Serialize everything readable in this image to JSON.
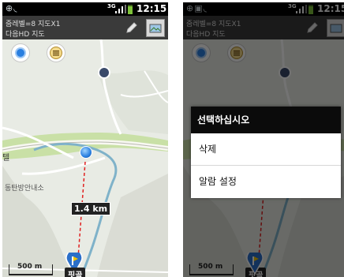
{
  "statusbar": {
    "network": "3G",
    "time": "12:15"
  },
  "titlebar": {
    "line1": "줌레벨=8 지도X1",
    "line2": "다음HD 지도"
  },
  "map": {
    "place_left_1": "텔",
    "place_left_2": "동탄방안내소",
    "distance": "1.4 km",
    "destination": "핏골",
    "scale": "500 m"
  },
  "dialog": {
    "title": "선택하십시오",
    "items": [
      "삭제",
      "알람 설정"
    ]
  },
  "colors": {
    "accent_blue": "#2a7fe0",
    "route_red": "#e02020",
    "water": "#7fb2c9",
    "greenbelt": "#c9e0a6"
  },
  "icons": [
    "location-icon",
    "list-icon",
    "pencil-icon",
    "layers-icon",
    "flag-icon",
    "gps-icon",
    "wifi-icon"
  ]
}
